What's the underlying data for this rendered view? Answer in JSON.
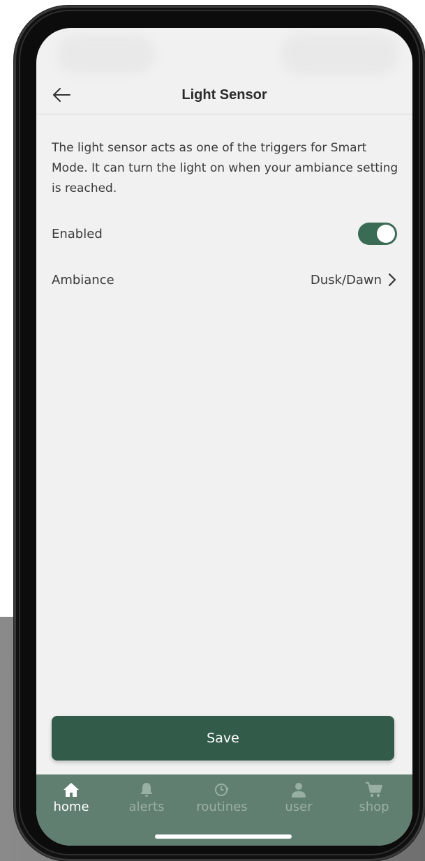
{
  "header": {
    "title": "Light Sensor"
  },
  "description": "The light sensor acts as one of the triggers for Smart Mode. It can turn the light on when your ambiance setting is reached.",
  "settings": {
    "enabled_label": "Enabled",
    "enabled_on": true,
    "ambiance_label": "Ambiance",
    "ambiance_value": "Dusk/Dawn"
  },
  "save_label": "Save",
  "tabs": [
    {
      "label": "home",
      "icon": "home-icon",
      "active": true
    },
    {
      "label": "alerts",
      "icon": "bell-icon",
      "active": false
    },
    {
      "label": "routines",
      "icon": "clock-icon",
      "active": false
    },
    {
      "label": "user",
      "icon": "user-icon",
      "active": false
    },
    {
      "label": "shop",
      "icon": "cart-icon",
      "active": false
    }
  ],
  "colors": {
    "accent": "#335b4a",
    "toggle_on": "#3a6b55",
    "tabbar": "#617f70",
    "tab_inactive": "#98b0a4"
  }
}
